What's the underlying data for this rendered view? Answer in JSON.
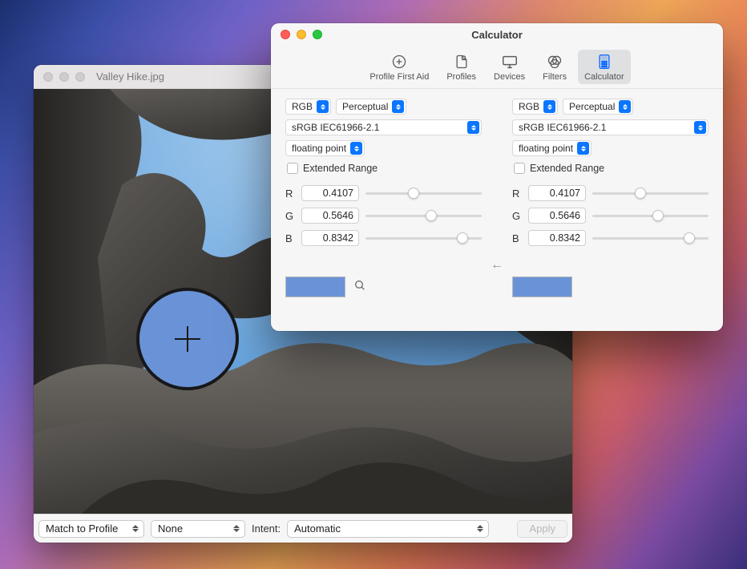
{
  "viewer": {
    "title": "Valley Hike.jpg",
    "bottombar": {
      "action": "Match to Profile",
      "profile": "None",
      "intent_label": "Intent:",
      "intent_value": "Automatic",
      "apply": "Apply"
    }
  },
  "calc": {
    "title": "Calculator",
    "tabs": [
      {
        "id": "profile-first-aid",
        "label": "Profile First Aid"
      },
      {
        "id": "profiles",
        "label": "Profiles"
      },
      {
        "id": "devices",
        "label": "Devices"
      },
      {
        "id": "filters",
        "label": "Filters"
      },
      {
        "id": "calculator",
        "label": "Calculator"
      }
    ],
    "left": {
      "colorspace": "RGB",
      "intent": "Perceptual",
      "profile": "sRGB IEC61966-2.1",
      "format": "floating point",
      "extended_label": "Extended Range",
      "channels": {
        "r_label": "R",
        "g_label": "G",
        "b_label": "B",
        "r": "0.4107",
        "g": "0.5646",
        "b": "0.8342"
      },
      "swatch_color": "#6a93d7"
    },
    "right": {
      "colorspace": "RGB",
      "intent": "Perceptual",
      "profile": "sRGB IEC61966-2.1",
      "format": "floating point",
      "extended_label": "Extended Range",
      "channels": {
        "r_label": "R",
        "g_label": "G",
        "b_label": "B",
        "r": "0.4107",
        "g": "0.5646",
        "b": "0.8342"
      },
      "swatch_color": "#6a93d7"
    },
    "arrow": "←"
  }
}
